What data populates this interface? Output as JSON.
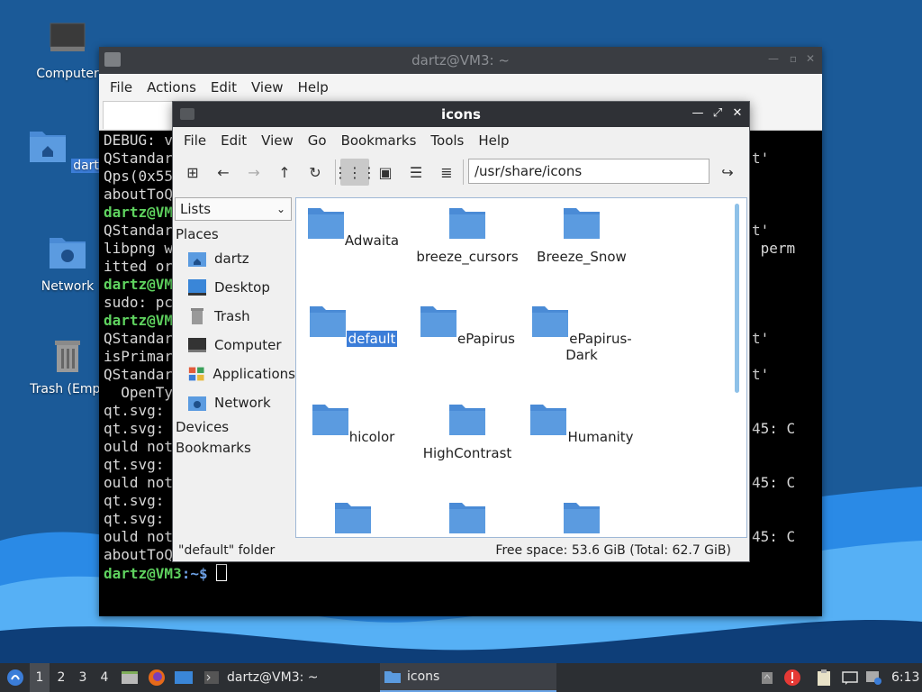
{
  "desktop": {
    "icons": [
      {
        "label": "Computer",
        "icon": "computer-icon"
      },
      {
        "label": "dartz",
        "icon": "home-folder-icon"
      },
      {
        "label": "Network",
        "icon": "network-folder-icon"
      },
      {
        "label": "Trash (Empt",
        "icon": "trash-icon"
      }
    ]
  },
  "terminal": {
    "title": "dartz@VM3: ~",
    "menu": [
      "File",
      "Actions",
      "Edit",
      "View",
      "Help"
    ],
    "lines": [
      "DEBUG: v",
      "QStandar",
      "Qps(0x55",
      "aboutToQ",
      "dartz@VM",
      "QStandar",
      "libpng w",
      "itted or",
      "dartz@VM",
      "sudo: pc",
      "dartz@VM",
      "QStandar",
      "isPrimar",
      "QStandar",
      "  OpenTy",
      "qt.svg: ",
      "qt.svg: ",
      "ould not",
      "qt.svg: ",
      "ould not",
      "qt.svg: ",
      "qt.svg: ",
      "ould not",
      "aboutToQuit"
    ],
    "right_lines": [
      "",
      "t'",
      "",
      "",
      "",
      "t'",
      " perm",
      "",
      "",
      "",
      "",
      "t'",
      "",
      "t'",
      "",
      "",
      "45: C",
      "",
      "",
      "45: C",
      "",
      "",
      "45: C",
      ""
    ],
    "prompt_user": "dartz@VM3",
    "prompt_path": ":~$"
  },
  "filemanager": {
    "title": "icons",
    "menu": [
      "File",
      "Edit",
      "View",
      "Go",
      "Bookmarks",
      "Tools",
      "Help"
    ],
    "path": "/usr/share/icons",
    "sidebar_mode": "Lists",
    "places_header": "Places",
    "places": [
      {
        "label": "dartz",
        "icon": "home-icon"
      },
      {
        "label": "Desktop",
        "icon": "desktop-icon"
      },
      {
        "label": "Trash",
        "icon": "trash-icon"
      },
      {
        "label": "Computer",
        "icon": "computer-icon"
      },
      {
        "label": "Applications",
        "icon": "applications-icon"
      },
      {
        "label": "Network",
        "icon": "network-icon"
      }
    ],
    "devices_header": "Devices",
    "bookmarks_header": "Bookmarks",
    "folders": [
      "Adwaita",
      "breeze_cursors",
      "Breeze_Snow",
      "default",
      "ePapirus",
      "ePapirus-Dark",
      "hicolor",
      "HighContrast",
      "Humanity",
      "",
      "",
      ""
    ],
    "selected_folder": "default",
    "status_left": "\"default\" folder",
    "status_right": "Free space: 53.6 GiB (Total: 62.7 GiB)"
  },
  "taskbar": {
    "workspaces": [
      "1",
      "2",
      "3",
      "4"
    ],
    "active_workspace": "1",
    "tasks": [
      {
        "label": "dartz@VM3: ~",
        "icon": "terminal-icon"
      },
      {
        "label": "icons",
        "icon": "folder-icon"
      }
    ],
    "clock": "6:13"
  },
  "colors": {
    "accent": "#3b7dd8",
    "folder": "#5b9be0",
    "terminal_green": "#5fd35f",
    "taskbar": "#2c2f33"
  }
}
